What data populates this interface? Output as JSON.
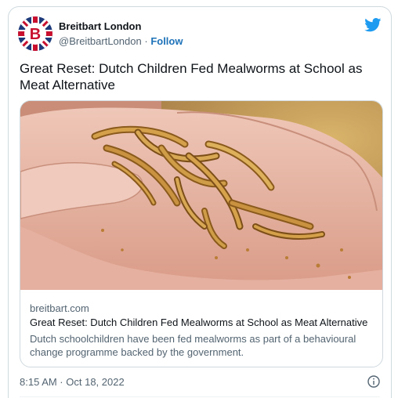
{
  "account": {
    "name": "Breitbart London",
    "handle": "@BreitbartLondon",
    "separator": "·",
    "follow_label": "Follow",
    "avatar_icon": "breitbart-b-logo-icon",
    "platform_icon": "twitter-bird-icon"
  },
  "tweet": {
    "text": "Great Reset: Dutch Children Fed Mealworms at School as Meat Alternative",
    "timestamp": "8:15 AM · Oct 18, 2022"
  },
  "link_card": {
    "domain": "breitbart.com",
    "title": "Great Reset: Dutch Children Fed Mealworms at School as Meat Alternative",
    "description": "Dutch schoolchildren have been fed mealworms as part of a behavioural change programme backed by the government.",
    "image_alt": "mealworms-in-hand-photo"
  },
  "colors": {
    "accent": "#1d9bf0",
    "follow": "#1d72b8",
    "secondary_text": "#536471",
    "border": "#cfd9de"
  }
}
